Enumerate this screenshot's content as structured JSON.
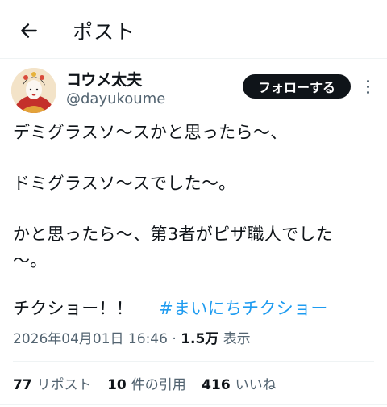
{
  "header": {
    "title": "ポスト",
    "back_icon": "arrow-left-icon"
  },
  "author": {
    "display_name": "コウメ太夫",
    "handle": "@dayukoume",
    "avatar_icon": "avatar"
  },
  "follow_label": "フォローする",
  "more_icon": "more-vertical-icon",
  "tweet": {
    "line1": "デミグラスソ〜スかと思ったら〜、",
    "line2": "ドミグラスソ〜スでした〜。",
    "line3": "かと思ったら〜、第3者がピザ職人でした",
    "line4": "〜。",
    "line5_text": "チクショー！！",
    "hashtag": "#まいにちチクショー"
  },
  "meta": {
    "timestamp": "2026年04月01日 16:46",
    "separator": "·",
    "views": "1.5万",
    "views_label": "表示"
  },
  "stats": {
    "reposts_count": "77",
    "reposts_label": "リポスト",
    "quotes_count": "10",
    "quotes_label": "件の引用",
    "likes_count": "416",
    "likes_label": "いいね"
  },
  "colors": {
    "accent": "#1d9bf0",
    "text": "#0f1419",
    "secondary": "#536471",
    "follow_bg": "#0f1419"
  }
}
